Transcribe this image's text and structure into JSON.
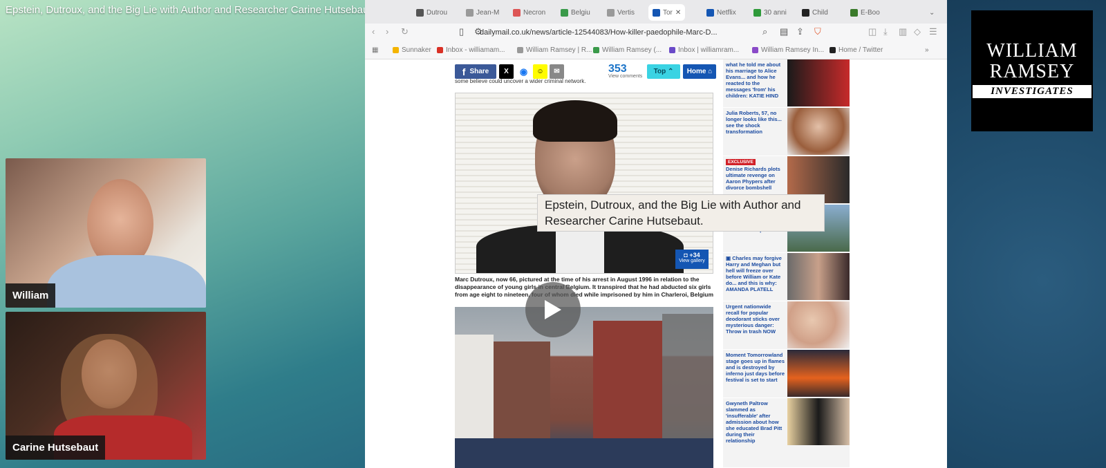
{
  "video": {
    "title": "Epstein, Dutroux, and the Big Lie with Author and Researcher Carine Hutsebaut.",
    "tooltip": "Epstein, Dutroux, and the Big Lie with Author and Researcher Carine Hutsebaut."
  },
  "participants": [
    {
      "name": "William"
    },
    {
      "name": "Carine Hutsebaut"
    }
  ],
  "browser": {
    "tabs": [
      "Dutrou",
      "Jean-M",
      "Necron",
      "Belgiu",
      "Vertis",
      "Tor",
      "Netflix",
      "30 anni",
      "Child",
      "E-Boo"
    ],
    "url": "dailymail.co.uk/news/article-12544083/How-killer-paedophile-Marc-D...",
    "bookmarks": [
      "Sunnaker",
      "Inbox - williamam...",
      "William Ramsey | R...",
      "William Ramsey (...",
      "Inbox | williamram...",
      "William Ramsey In...",
      "Home / Twitter"
    ]
  },
  "article": {
    "share_label": "Share",
    "comment_count": "353",
    "comment_caption": "View comments",
    "top_label": "Top",
    "home_label": "Home",
    "snippet": "some believe could uncover a wider criminal network.",
    "gallery_count": "+34",
    "gallery_label": "View gallery",
    "caption": "Marc Dutroux, now 66, pictured at the time of his arrest in August 1996 in relation to the disappearance of young girls in central Belgium. It transpired that he had abducted six girls from age eight to nineteen, four of whom died while imprisoned by him in Charleroi, Belgium"
  },
  "sidebar_items": [
    {
      "text": "what he told me about his marriage to Alice Evans... and how he reacted to the messages 'from' his children: KATIE HIND",
      "badge": ""
    },
    {
      "text": "Julia Roberts, 57, no longer looks like this... see the shock transformation",
      "badge": ""
    },
    {
      "text": "Denise Richards plots ultimate revenge on Aaron Phypers after divorce bombshell",
      "badge": "EXCLUSIVE"
    },
    {
      "text": "leaves - for trip",
      "badge": ""
    },
    {
      "text": "Charles may forgive Harry and Meghan but hell will freeze over before William or Kate do... and this is why: AMANDA PLATELL",
      "badge": ""
    },
    {
      "text": "Urgent nationwide recall for popular deodorant sticks over mysterious danger: Throw in trash NOW",
      "badge": ""
    },
    {
      "text": "Moment Tomorrowland stage goes up in flames and is destroyed by inferno just days before festival is set to start",
      "badge": ""
    },
    {
      "text": "Gwyneth Paltrow slammed as 'insufferable' after admission about how she educated Brad Pitt during their relationship",
      "badge": ""
    }
  ],
  "logo": {
    "line1": "WILLIAM",
    "line2": "RAMSEY",
    "line3": "INVESTIGATES"
  },
  "colors": {
    "facebook": "#3b5998",
    "twitter": "#000000",
    "dm_blue": "#1456b3",
    "top_cyan": "#3ad3e3"
  }
}
